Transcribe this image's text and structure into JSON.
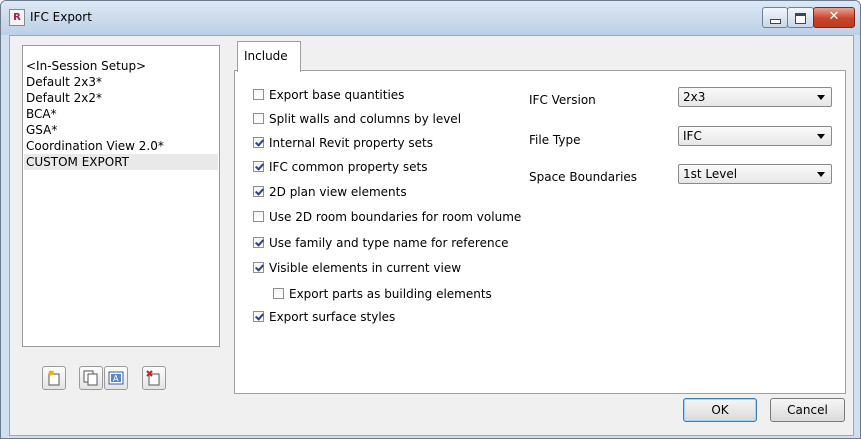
{
  "window": {
    "title": "IFC Export",
    "app_icon_letter": "R",
    "close_glyph": "✕"
  },
  "setups": [
    {
      "label": "<In-Session Setup>",
      "selected": false
    },
    {
      "label": "Default 2x3*",
      "selected": false
    },
    {
      "label": "Default 2x2*",
      "selected": false
    },
    {
      "label": "BCA*",
      "selected": false
    },
    {
      "label": "GSA*",
      "selected": false
    },
    {
      "label": "Coordination View 2.0*",
      "selected": false
    },
    {
      "label": "CUSTOM EXPORT",
      "selected": true
    }
  ],
  "toolbar": [
    {
      "name": "new-setup-button",
      "icon": "new-setup-icon"
    },
    {
      "name": "duplicate-setup-button",
      "icon": "duplicate-icon"
    },
    {
      "name": "rename-setup-button",
      "icon": "rename-icon"
    },
    {
      "name": "delete-setup-button",
      "icon": "delete-icon"
    }
  ],
  "tab": {
    "label": "Include"
  },
  "options": [
    {
      "label": "Export base quantities",
      "checked": false
    },
    {
      "label": "Split walls and columns by level",
      "checked": false
    },
    {
      "label": "Internal Revit property sets",
      "checked": true
    },
    {
      "label": "IFC common property sets",
      "checked": true
    },
    {
      "label": "2D plan view elements",
      "checked": true
    },
    {
      "label": "Use 2D room boundaries for room volume",
      "checked": false
    },
    {
      "label": "Use family and type name for reference",
      "checked": true
    },
    {
      "label": "Visible elements in current view",
      "checked": true
    },
    {
      "label": "Export parts as building elements",
      "checked": false
    },
    {
      "label": "Export surface styles",
      "checked": true
    }
  ],
  "settings": {
    "ifc_version": {
      "label": "IFC Version",
      "value": "2x3"
    },
    "file_type": {
      "label": "File Type",
      "value": "IFC"
    },
    "space_boundaries": {
      "label": "Space Boundaries",
      "value": "1st Level"
    }
  },
  "buttons": {
    "ok": "OK",
    "cancel": "Cancel"
  }
}
